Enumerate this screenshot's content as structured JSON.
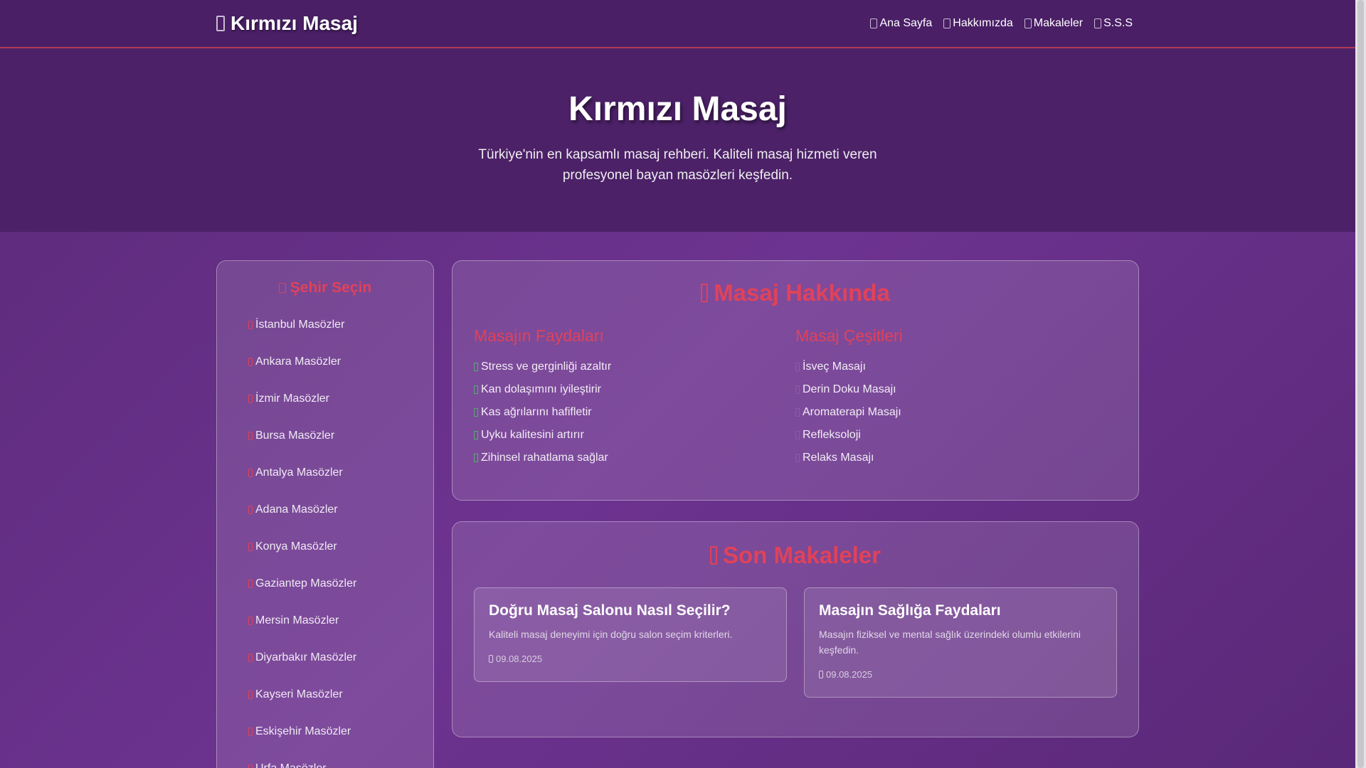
{
  "brand": "Kırmızı Masaj",
  "nav": [
    "Ana Sayfa",
    "Hakkımızda",
    "Makaleler",
    "S.S.S"
  ],
  "hero": {
    "title": "Kırmızı Masaj",
    "subtitle": "Türkiye'nin en kapsamlı masaj rehberi. Kaliteli masaj hizmeti veren profesyonel bayan masözleri keşfedin."
  },
  "sidebar": {
    "title": "Şehir Seçin",
    "cities": [
      "İstanbul Masözler",
      "Ankara Masözler",
      "İzmir Masözler",
      "Bursa Masözler",
      "Antalya Masözler",
      "Adana Masözler",
      "Konya Masözler",
      "Gaziantep Masözler",
      "Mersin Masözler",
      "Diyarbakır Masözler",
      "Kayseri Masözler",
      "Eskişehir Masözler",
      "Urfa Masözler"
    ]
  },
  "about": {
    "title": "Masaj Hakkında",
    "benefits_title": "Masajın Faydaları",
    "benefits": [
      "Stress ve gerginliği azaltır",
      "Kan dolaşımını iyileştirir",
      "Kas ağrılarını hafifletir",
      "Uyku kalitesini artırır",
      "Zihinsel rahatlama sağlar"
    ],
    "types_title": "Masaj Çeşitleri",
    "types": [
      "İsveç Masajı",
      "Derin Doku Masajı",
      "Aromaterapi Masajı",
      "Refleksoloji",
      "Relaks Masajı"
    ]
  },
  "articles": {
    "title": "Son Makaleler",
    "items": [
      {
        "title": "Doğru Masaj Salonu Nasıl Seçilir?",
        "text": "Kaliteli masaj deneyimi için doğru salon seçim kriterleri.",
        "date": "09.08.2025"
      },
      {
        "title": "Masajın Sağlığa Faydaları",
        "text": "Masajın fiziksel ve mental sağlık üzerindeki olumlu etkilerini keşfedin.",
        "date": "09.08.2025"
      }
    ]
  },
  "colors": {
    "accent": "#e0425a",
    "header": "#4a1f66",
    "check": "#4fb06a"
  }
}
